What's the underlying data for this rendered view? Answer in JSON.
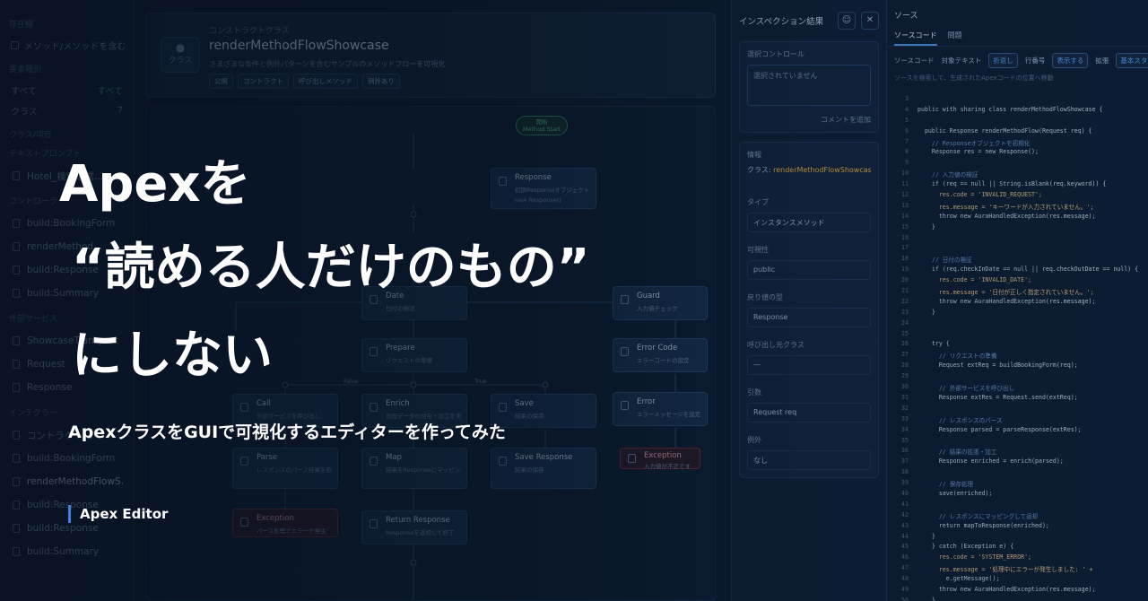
{
  "sidebar": {
    "top_section": "存在棚",
    "checkbox_label": "メソッド/メソッドを含む",
    "kind_section": "要素種別",
    "kinds": [
      {
        "label": "すべて",
        "value": "すべて"
      },
      {
        "label": "クラス",
        "value": "7"
      }
    ],
    "items": [
      "クラス/項目",
      "テキストプロンプト",
      "Hotel_検索通常…",
      "コントローラー",
      "build:BookingForm",
      "renderMethod…",
      "build:Response",
      "build:Summary",
      "外部サービス",
      "ShowcaseTransport",
      "Request",
      "Response",
      "インテグラー",
      "コントラクト…",
      "build:BookingForm",
      "renderMethodFlowS…",
      "build:Response",
      "build:Response",
      "build:Summary"
    ]
  },
  "class_card": {
    "type_label": "コンストラクトクラス",
    "icon_label": "クラス",
    "name": "renderMethodFlowShowcase",
    "description": "さまざまな条件と例外パターンを含むサンプルのメソッドフローを可視化",
    "tags": [
      "公開",
      "コントラクト",
      "呼び出しメソッド",
      "例外あり"
    ]
  },
  "flow": {
    "start": {
      "title": "開始",
      "subtitle": "Method Start"
    },
    "branch_false": "False",
    "branch_true": "True",
    "nodes": [
      {
        "id": "response",
        "title": "Response",
        "sub": "初期Responseオブジェクトを構築",
        "extra": "new Response()"
      },
      {
        "id": "date",
        "title": "Date",
        "sub": "日付の検証"
      },
      {
        "id": "prepare",
        "title": "Prepare",
        "sub": "リクエストの準備"
      },
      {
        "id": "call",
        "title": "Call",
        "sub": "外部サービスを呼び出し"
      },
      {
        "id": "enrich",
        "title": "Enrich",
        "sub": "追加データの付与・加工を実行"
      },
      {
        "id": "save",
        "title": "Save",
        "sub": "結果の保存"
      },
      {
        "id": "parse",
        "title": "Parse",
        "sub": "レスポンスのパース結果を取り出す"
      },
      {
        "id": "map",
        "title": "Map",
        "sub": "結果をResponseにマッピング"
      },
      {
        "id": "save-response",
        "title": "Save Response",
        "sub": "結果の保存"
      },
      {
        "id": "return-response",
        "title": "Return Response",
        "sub": "Responseを返却して終了"
      },
      {
        "id": "guard",
        "title": "Guard",
        "sub": "入力値チェック"
      },
      {
        "id": "error-code",
        "title": "Error Code",
        "sub": "エラーコードの設定"
      },
      {
        "id": "error",
        "title": "Error",
        "sub": "エラーメッセージを設定"
      },
      {
        "id": "exception-left",
        "title": "Exception",
        "sub": "パース処理でエラーが発生"
      },
      {
        "id": "exception-right",
        "title": "Exception",
        "sub": "入力値が不正です"
      }
    ]
  },
  "inspect": {
    "title": "インスペクション結果",
    "selected_label": "選択コントロール",
    "selected_placeholder": "選択されていません",
    "comment_link": "コメントを追加",
    "info_label": "情報",
    "class_field_label": "クラス:",
    "class_field_value": "renderMethodFlowShowcase",
    "type_label": "タイプ",
    "type_value": "インスタンスメソッド",
    "visibility_label": "可視性",
    "visibility_value": "public",
    "return_label": "戻り値の型",
    "return_value": "Response",
    "caller_label": "呼び出し元クラス",
    "caller_value": "—",
    "args_label": "引数",
    "args_value": "Request req",
    "exception_label": "例外",
    "exception_value": "なし"
  },
  "source": {
    "title": "ソース",
    "tabs": [
      "ソースコード",
      "問題"
    ],
    "toolbar_label": "ソースコード",
    "match_label": "対象テキスト",
    "toggle_label": "折返し",
    "mode_label": "行番号",
    "mode_value": "表示する",
    "size_label": "拡張",
    "style_value": "基本スタイル",
    "search_hint": "ソースを検索して、生成されたApexコードの位置へ移動"
  },
  "code": [
    {
      "n": "3",
      "t": "",
      "k": "ct"
    },
    {
      "n": "4",
      "t": "public with sharing class renderMethodFlowShowcase {",
      "k": "ct"
    },
    {
      "n": "5",
      "t": "",
      "k": "ct"
    },
    {
      "n": "6",
      "t": "  public Response renderMethodFlow(Request req) {",
      "k": "ct"
    },
    {
      "n": "7",
      "t": "    // Responseオブジェクトを初期化",
      "k": "ct cm"
    },
    {
      "n": "8",
      "t": "    Response res = new Response();",
      "k": "ct"
    },
    {
      "n": "9",
      "t": "",
      "k": "ct"
    },
    {
      "n": "10",
      "t": "    // 入力値の検証",
      "k": "ct cm"
    },
    {
      "n": "11",
      "t": "    if (req == null || String.isBlank(req.keyword)) {",
      "k": "ct"
    },
    {
      "n": "12",
      "t": "      res.code = 'INVALID_REQUEST';",
      "k": "ct str"
    },
    {
      "n": "13",
      "t": "      res.message = 'キーワードが入力されていません。';",
      "k": "ct str"
    },
    {
      "n": "14",
      "t": "      throw new AuraHandledException(res.message);",
      "k": "ct"
    },
    {
      "n": "15",
      "t": "    }",
      "k": "ct"
    },
    {
      "n": "16",
      "t": "",
      "k": "ct"
    },
    {
      "n": "17",
      "t": "",
      "k": "ct"
    },
    {
      "n": "18",
      "t": "    // 日付の検証",
      "k": "ct cm"
    },
    {
      "n": "19",
      "t": "    if (req.checkInDate == null || req.checkOutDate == null) {",
      "k": "ct"
    },
    {
      "n": "20",
      "t": "      res.code = 'INVALID_DATE';",
      "k": "ct str"
    },
    {
      "n": "21",
      "t": "      res.message = '日付が正しく指定されていません。';",
      "k": "ct str"
    },
    {
      "n": "22",
      "t": "      throw new AuraHandledException(res.message);",
      "k": "ct"
    },
    {
      "n": "23",
      "t": "    }",
      "k": "ct"
    },
    {
      "n": "24",
      "t": "",
      "k": "ct"
    },
    {
      "n": "25",
      "t": "",
      "k": "ct"
    },
    {
      "n": "26",
      "t": "    try {",
      "k": "ct"
    },
    {
      "n": "27",
      "t": "      // リクエストの準備",
      "k": "ct cm"
    },
    {
      "n": "28",
      "t": "      Request extReq = buildBookingForm(req);",
      "k": "ct"
    },
    {
      "n": "29",
      "t": "",
      "k": "ct"
    },
    {
      "n": "30",
      "t": "      // 外部サービスを呼び出し",
      "k": "ct cm"
    },
    {
      "n": "31",
      "t": "      Response extRes = Request.send(extReq);",
      "k": "ct"
    },
    {
      "n": "32",
      "t": "",
      "k": "ct"
    },
    {
      "n": "33",
      "t": "      // レスポンスのパース",
      "k": "ct cm"
    },
    {
      "n": "34",
      "t": "      Response parsed = parseResponse(extRes);",
      "k": "ct"
    },
    {
      "n": "35",
      "t": "",
      "k": "ct"
    },
    {
      "n": "36",
      "t": "      // 結果の拡張・加工",
      "k": "ct cm"
    },
    {
      "n": "37",
      "t": "      Response enriched = enrich(parsed);",
      "k": "ct"
    },
    {
      "n": "38",
      "t": "",
      "k": "ct"
    },
    {
      "n": "39",
      "t": "      // 保存処理",
      "k": "ct cm"
    },
    {
      "n": "40",
      "t": "      save(enriched);",
      "k": "ct"
    },
    {
      "n": "41",
      "t": "",
      "k": "ct"
    },
    {
      "n": "42",
      "t": "      // レスポンスにマッピングして返却",
      "k": "ct cm"
    },
    {
      "n": "43",
      "t": "      return mapToResponse(enriched);",
      "k": "ct"
    },
    {
      "n": "44",
      "t": "    }",
      "k": "ct"
    },
    {
      "n": "45",
      "t": "    } catch (Exception e) {",
      "k": "ct"
    },
    {
      "n": "46",
      "t": "      res.code = 'SYSTEM_ERROR';",
      "k": "ct str"
    },
    {
      "n": "47",
      "t": "      res.message = '処理中にエラーが発生しました: ' +",
      "k": "ct str"
    },
    {
      "n": "48",
      "t": "        e.getMessage();",
      "k": "ct"
    },
    {
      "n": "49",
      "t": "      throw new AuraHandledException(res.message);",
      "k": "ct"
    },
    {
      "n": "50",
      "t": "    }",
      "k": "ct"
    }
  ],
  "overlay": {
    "title_line1": "Apexを",
    "title_line2": "“読める人だけのもの”",
    "title_line3": "にしない",
    "subtitle": "ApexクラスをGUIで可視化するエディターを作ってみた",
    "brand": "Apex Editor"
  }
}
